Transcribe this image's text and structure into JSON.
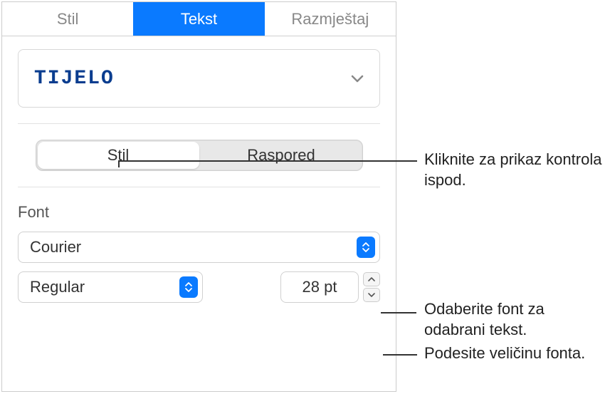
{
  "tabs": {
    "stil": "Stil",
    "tekst": "Tekst",
    "razmjestaj": "Razmještaj"
  },
  "paragraphStyle": {
    "label": "TIJELO"
  },
  "segmented": {
    "stil": "Stil",
    "raspored": "Raspored"
  },
  "font": {
    "sectionLabel": "Font",
    "family": "Courier",
    "weight": "Regular",
    "size": "28 pt"
  },
  "callouts": {
    "segmented": "Kliknite za prikaz kontrola ispod.",
    "fontFamily": "Odaberite font za odabrani tekst.",
    "fontSize": "Podesite veličinu fonta."
  }
}
